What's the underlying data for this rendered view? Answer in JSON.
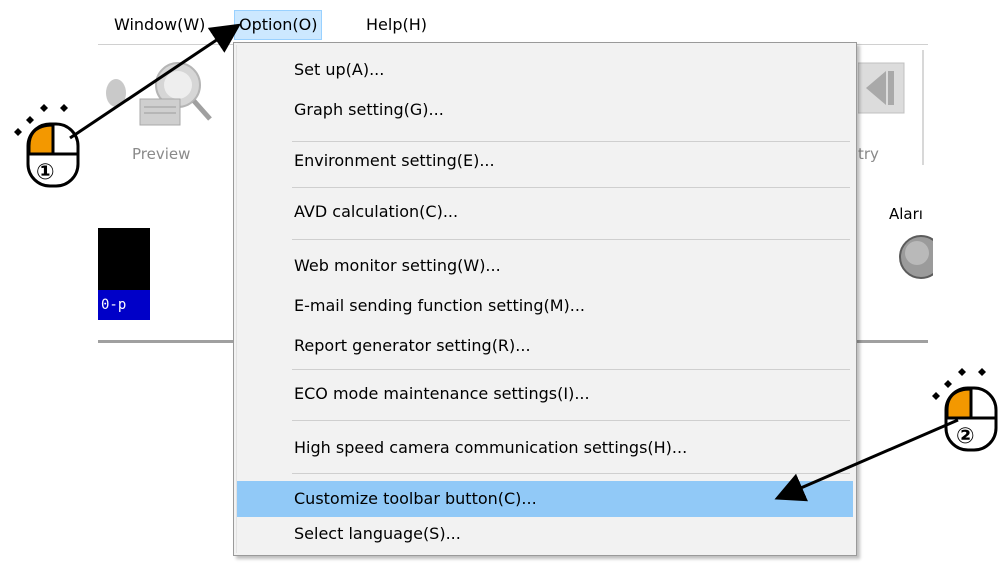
{
  "menubar": {
    "items": [
      {
        "label": "Window(W)"
      },
      {
        "label": "Option(O)"
      },
      {
        "label": "Help(H)"
      }
    ]
  },
  "toolbar": {
    "preview_label": "Preview",
    "retry_label": "try"
  },
  "panel": {
    "alarm_label": "Aları",
    "tag_text": "0-p"
  },
  "option_menu": {
    "items": [
      {
        "label": "Set up(A)..."
      },
      {
        "label": "Graph setting(G)..."
      },
      {
        "label": "Environment setting(E)..."
      },
      {
        "label": "AVD calculation(C)..."
      },
      {
        "label": "Web monitor setting(W)..."
      },
      {
        "label": "E-mail sending function setting(M)..."
      },
      {
        "label": "Report generator setting(R)..."
      },
      {
        "label": "ECO mode maintenance settings(I)..."
      },
      {
        "label": "High speed camera communication settings(H)..."
      },
      {
        "label": "Customize toolbar button(C)..."
      },
      {
        "label": "Select language(S)..."
      }
    ],
    "highlighted_item": "Customize toolbar button(C)..."
  },
  "annotations": {
    "step1": "①",
    "step2": "②"
  },
  "colors": {
    "menu_highlight": "#91c9f7",
    "menubar_active": "#cce8ff",
    "mouse_button": "#f39800",
    "tag_blue": "#0000c8"
  }
}
